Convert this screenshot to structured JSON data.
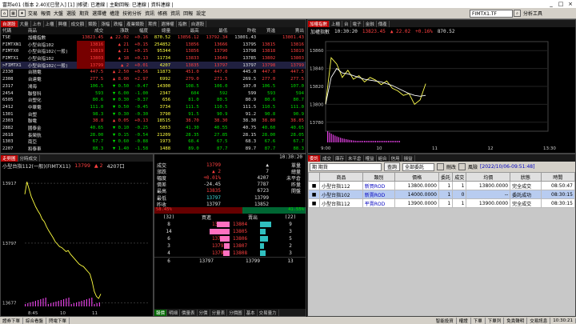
{
  "window": {
    "title": "富邦e01 (版本 2.40)[已登入]  [1]  |帳號: 已連線 | 主動回報: 已連線 | 資料連線 |",
    "min": "_",
    "max": "□",
    "close": "×"
  },
  "menu": {
    "items": [
      "交易",
      "報價",
      "大盤",
      "選股",
      "期貨",
      "選擇權",
      "權證",
      "技術分析",
      "資訊",
      "帳務",
      "資訊",
      "回報",
      "設定"
    ],
    "symbol_field": "FIMTX1.TF",
    "analysis_label": "分析工具"
  },
  "quote_panel": {
    "tabs": [
      "自選股",
      "大量",
      "上市",
      "上櫃",
      "興櫃",
      "成交額",
      "類股",
      "漲幅",
      "跌幅",
      "產業類股",
      "期貨",
      "選擇權",
      "指數",
      "自選股"
    ],
    "headers": [
      "代碼",
      "商品",
      "成交",
      "漲跌",
      "幅度",
      "總量",
      "最高",
      "最低",
      "昨收",
      "買進",
      "賣出"
    ],
    "rows": [
      {
        "code": "TSE",
        "name": "加權指數",
        "price": "13823.45",
        "chg": "▲ 22.02",
        "pct": "+0.16",
        "vol": "870.52",
        "hi": "13856.12",
        "lo": "13792.34",
        "prev": "13801.43",
        "bid": "",
        "ask": "13801.43",
        "cls": "r"
      },
      {
        "code": "FIMTXN1",
        "name": "小型台指102",
        "price": "13816",
        "chg": "▲ 21",
        "pct": "+0.15",
        "vol": "254852",
        "hi": "13856",
        "lo": "13666",
        "prev": "13795",
        "bid": "13815",
        "ask": "13816",
        "cls": "r"
      },
      {
        "code": "FIMTX0",
        "name": "小型台指102(一般)",
        "price": "13819",
        "chg": "▲ 21",
        "pct": "+0.15",
        "vol": "95344",
        "hi": "13856",
        "lo": "13790",
        "prev": "13798",
        "bid": "13818",
        "ask": "13819",
        "cls": "r"
      },
      {
        "code": "FIMTX1",
        "name": "小型台指102",
        "price": "13803",
        "chg": "▲ 18",
        "pct": "+0.13",
        "vol": "11734",
        "hi": "13833",
        "lo": "13649",
        "prev": "13785",
        "bid": "13802",
        "ask": "13803",
        "cls": "r"
      },
      {
        "code": ">FIMTX1",
        "name": "小型台指102(一般)",
        "price": "13799",
        "chg": "▲ 2",
        "pct": "+0.01",
        "vol": "4207",
        "hi": "13835",
        "lo": "13797",
        "prev": "13797",
        "bid": "13798",
        "ask": "13799",
        "cls": "r"
      },
      {
        "code": "2330",
        "name": "台積電",
        "price": "447.5",
        "chg": "▲ 2.50",
        "pct": "+0.56",
        "vol": "11873",
        "hi": "451.0",
        "lo": "447.0",
        "prev": "445.0",
        "bid": "447.0",
        "ask": "447.5",
        "cls": "r"
      },
      {
        "code": "2308",
        "name": "台達電",
        "price": "277.5",
        "chg": "▲ 8.00",
        "pct": "+2.97",
        "vol": "6992",
        "hi": "279.0",
        "lo": "271.5",
        "prev": "269.5",
        "bid": "277.0",
        "ask": "277.5",
        "cls": "r"
      },
      {
        "code": "2317",
        "name": "鴻海",
        "price": "106.5",
        "chg": "▼ 0.50",
        "pct": "-0.47",
        "vol": "14300",
        "hi": "108.5",
        "lo": "106.0",
        "prev": "107.0",
        "bid": "106.5",
        "ask": "107.0",
        "cls": "g"
      },
      {
        "code": "2454",
        "name": "聯發科",
        "price": "593",
        "chg": "▼ 6.00",
        "pct": "-1.00",
        "vol": "2347",
        "hi": "604",
        "lo": "592",
        "prev": "599",
        "bid": "593",
        "ask": "594",
        "cls": "g"
      },
      {
        "code": "6505",
        "name": "台塑化",
        "price": "80.6",
        "chg": "▼ 0.30",
        "pct": "-0.37",
        "vol": "656",
        "hi": "81.0",
        "lo": "80.5",
        "prev": "80.9",
        "bid": "80.6",
        "ask": "80.7",
        "cls": "g"
      },
      {
        "code": "2412",
        "name": "中華電",
        "price": "111.0",
        "chg": "▼ 0.50",
        "pct": "-0.45",
        "vol": "3734",
        "hi": "111.5",
        "lo": "110.5",
        "prev": "111.5",
        "bid": "110.5",
        "ask": "111.0",
        "cls": "g"
      },
      {
        "code": "1301",
        "name": "台塑",
        "price": "98.3",
        "chg": "▼ 0.30",
        "pct": "-0.30",
        "vol": "3790",
        "hi": "91.5",
        "lo": "90.9",
        "prev": "91.2",
        "bid": "90.8",
        "ask": "90.9",
        "cls": "g"
      },
      {
        "code": "2303",
        "name": "聯電",
        "price": "38.8",
        "chg": "▲ 0.05",
        "pct": "+0.13",
        "vol": "18515",
        "hi": "38.70",
        "lo": "38.30",
        "prev": "38.30",
        "bid": "38.80",
        "ask": "38.85",
        "cls": "r"
      },
      {
        "code": "2882",
        "name": "國泰金",
        "price": "40.65",
        "chg": "▼ 0.10",
        "pct": "-0.25",
        "vol": "5853",
        "hi": "41.30",
        "lo": "40.55",
        "prev": "40.75",
        "bid": "40.60",
        "ask": "40.65",
        "cls": "g"
      },
      {
        "code": "2618",
        "name": "長榮航",
        "price": "28.00",
        "chg": "▼ 0.15",
        "pct": "-0.54",
        "vol": "21209",
        "hi": "28.35",
        "lo": "27.85",
        "prev": "28.15",
        "bid": "28.00",
        "ask": "28.05",
        "cls": "g"
      },
      {
        "code": "1303",
        "name": "南亞",
        "price": "67.7",
        "chg": "▼ 0.60",
        "pct": "-0.88",
        "vol": "1973",
        "hi": "68.4",
        "lo": "67.5",
        "prev": "68.3",
        "bid": "67.6",
        "ask": "67.7",
        "cls": "g"
      },
      {
        "code": "2207",
        "name": "和泰車",
        "price": "88.3",
        "chg": "▼ 1.40",
        "pct": "-1.58",
        "vol": "1488",
        "hi": "89.0",
        "lo": "87.7",
        "prev": "89.7",
        "bid": "87.7",
        "ask": "88.3",
        "cls": "g"
      },
      {
        "code": "2002",
        "name": "中鋼",
        "price": "27.75",
        "chg": "▲ 0.15",
        "pct": "+0.54",
        "vol": "6733",
        "hi": "27.80",
        "lo": "27.45",
        "prev": "27.60",
        "bid": "27.70",
        "ask": "27.75",
        "cls": "r"
      }
    ]
  },
  "index_chart": {
    "tabs": [
      "加權指數",
      "上櫃",
      "台",
      "電子",
      "金融",
      "傳產"
    ],
    "label": "加權指數",
    "time": "10:30:20",
    "price": "13823.45",
    "chg": "▲ 22.02",
    "pct": "+0.16%",
    "vol": "870.52",
    "chart_data": {
      "type": "line",
      "x_ticks": [
        "9:00",
        "10",
        "11",
        "12",
        "13:30"
      ],
      "y_ticks": [
        "13860",
        "13840",
        "13820",
        "13800",
        "13780"
      ],
      "ylim": [
        13770,
        13870
      ],
      "series": [
        {
          "values": [
            13800,
            13852,
            13845,
            13830,
            13838,
            13828,
            13832,
            13825,
            13830,
            13827,
            13822,
            13826,
            13818,
            13815,
            13810,
            13812,
            13800,
            13805,
            13823
          ]
        },
        {
          "values": [
            13800,
            13830,
            13840,
            13835,
            13834,
            13832,
            13830,
            13828,
            13827,
            13826,
            13825,
            13823,
            13821,
            13818,
            13815,
            13812,
            13810,
            13809,
            13810
          ]
        }
      ]
    }
  },
  "tick_chart": {
    "tabs": [
      "走勢圖",
      "分時成交"
    ],
    "title": "小型台指112(一般)(FIMTX11)",
    "price": "13799",
    "chg": "▲ 2",
    "vol": "4207口",
    "y_ticks": [
      "13917",
      "13797",
      "13677"
    ],
    "x_ticks": [
      "8:45",
      "10",
      "11"
    ],
    "chart_data": {
      "type": "line",
      "ylim": [
        13670,
        13930
      ],
      "series": [
        {
          "values": [
            13895,
            13920,
            13905,
            13890,
            13880,
            13870,
            13862,
            13855,
            13845,
            13840,
            13830,
            13822,
            13815,
            13808,
            13800,
            13795,
            13790,
            13788,
            13784,
            13780,
            13782,
            13775,
            13770,
            13765,
            13760,
            13755,
            13752,
            13750,
            13745,
            13740,
            13735,
            13720,
            13700,
            13690,
            13686,
            13695
          ]
        }
      ]
    }
  },
  "quote_detail": {
    "time": "10:30:20",
    "rows": [
      {
        "k": "成交",
        "v": "13799",
        "k2": "▲",
        "v2": "單量",
        "cls": "r"
      },
      {
        "k": "漲跌",
        "v": "▲ 2",
        "k2": "7",
        "v2": "總量",
        "cls": "r"
      },
      {
        "k": "幅度",
        "v": "+0.01%",
        "k2": "4207",
        "v2": "未平倉",
        "cls": "r"
      },
      {
        "k": "價差",
        "v": "-24.45",
        "k2": "7787",
        "v2": "昨量",
        "cls": "w"
      },
      {
        "k": "最高",
        "v": "13835",
        "k2": "6723",
        "v2": "開盤",
        "cls": "r"
      },
      {
        "k": "最低",
        "v": "13797",
        "k2": "13799",
        "v2": "",
        "cls": "c"
      },
      {
        "k": "昨收",
        "v": "13797",
        "k2": "13852",
        "v2": "",
        "cls": "w"
      }
    ],
    "ratio_buy": "58.45%",
    "ratio_sell": "41.55%",
    "book_head": {
      "bq": "(32)",
      "bid": "買進",
      "ask": "賣出",
      "aq": "(22)"
    },
    "book": [
      {
        "bq": "8",
        "bid": "13798",
        "ask": "13804",
        "aq": "9",
        "bw": 55,
        "aw": 48
      },
      {
        "bq": "14",
        "bid": "13797",
        "ask": "13805",
        "aq": "3",
        "bw": 82,
        "aw": 22
      },
      {
        "bq": "6",
        "bid": "13796",
        "ask": "13806",
        "aq": "5",
        "bw": 40,
        "aw": 32
      },
      {
        "bq": "3",
        "bid": "13793",
        "ask": "13807",
        "aq": "2",
        "bw": 22,
        "aw": 15
      },
      {
        "bq": "4",
        "bid": "13791",
        "ask": "13808",
        "aq": "3",
        "bw": 28,
        "aw": 22
      }
    ],
    "book_total": {
      "bq": "6",
      "bid": "13797",
      "ask": "13799",
      "aq": "13"
    },
    "tabs": [
      "報價",
      "明細",
      "價量表",
      "分價",
      "分量表",
      "分價圖",
      "基本",
      "交易量力"
    ]
  },
  "orders": {
    "tabs": [
      "委託",
      "成交",
      "庫存",
      "未平倉",
      "權益",
      "組合",
      "信用",
      "損益"
    ],
    "account_label": "期 期貨",
    "query_label": "查詢",
    "filter_value": "全部委託",
    "delete_label": "刪改",
    "risk_label": "風險",
    "date_stamp": "[2022/10/06-09:51:48]",
    "headers": [
      "",
      "商品",
      "類別",
      "價格",
      "委託",
      "成交",
      "均價",
      "狀態",
      "時間"
    ],
    "rows": [
      {
        "product": "小型台指112",
        "type": "新買ROD",
        "price": "13800.0000",
        "qty": "1",
        "fill": "1",
        "avg": "13800.0000",
        "status": "完全成交",
        "time": "08:50:47"
      },
      {
        "product": "小型台指102",
        "type": "新賣ROD",
        "price": "14000.0000",
        "qty": "1",
        "fill": "0",
        "avg": "--",
        "status": "委託成功",
        "time": "08:30:15"
      },
      {
        "product": "小型台指112",
        "type": "平賣ROD",
        "price": "13900.0000",
        "qty": "1",
        "fill": "1",
        "avg": "13900.0000",
        "status": "完全成交",
        "time": "08:30:15"
      }
    ],
    "side_btns": [
      "刪",
      "改"
    ]
  },
  "status": {
    "items": [
      "證券下單",
      "綜合看盤",
      "閃電下單"
    ],
    "right": [
      "智能投資",
      "權證",
      "下單",
      "下單列",
      "免責聲明",
      "交易訊息",
      "10:30:21"
    ]
  }
}
